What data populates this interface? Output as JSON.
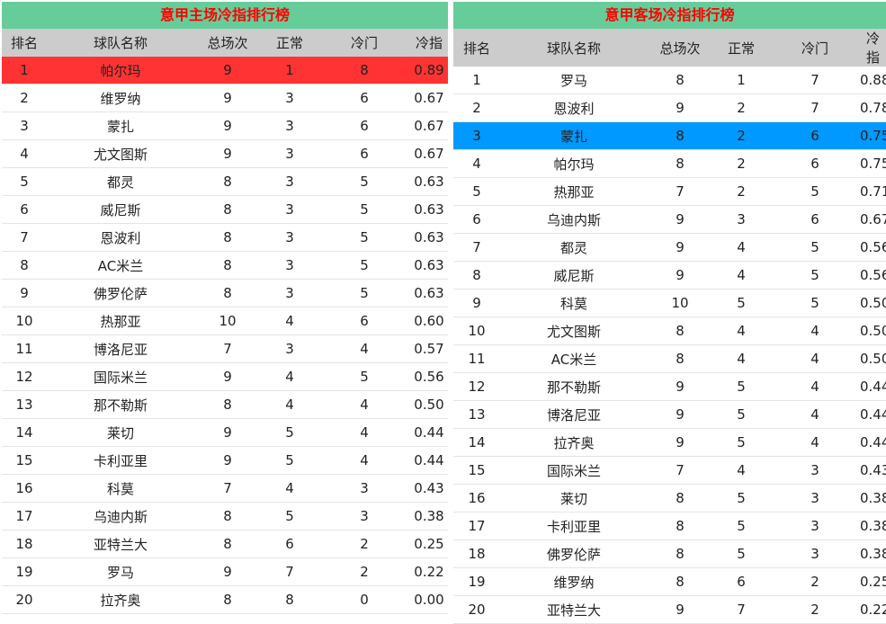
{
  "headers": [
    "排名",
    "球队名称",
    "总场次",
    "正常",
    "冷门",
    "冷指"
  ],
  "highlight_colors": {
    "red": "#ff3333",
    "blue": "#0099ff",
    "title_bg": "#66cc99",
    "title_text": "#ff0000"
  },
  "home": {
    "title": "意甲主场冷指排行榜",
    "rows": [
      [
        "1",
        "帕尔玛",
        "9",
        "1",
        "8",
        "0.89"
      ],
      [
        "2",
        "维罗纳",
        "9",
        "3",
        "6",
        "0.67"
      ],
      [
        "3",
        "蒙扎",
        "9",
        "3",
        "6",
        "0.67"
      ],
      [
        "4",
        "尤文图斯",
        "9",
        "3",
        "6",
        "0.67"
      ],
      [
        "5",
        "都灵",
        "8",
        "3",
        "5",
        "0.63"
      ],
      [
        "6",
        "威尼斯",
        "8",
        "3",
        "5",
        "0.63"
      ],
      [
        "7",
        "恩波利",
        "8",
        "3",
        "5",
        "0.63"
      ],
      [
        "8",
        "AC米兰",
        "8",
        "3",
        "5",
        "0.63"
      ],
      [
        "9",
        "佛罗伦萨",
        "8",
        "3",
        "5",
        "0.63"
      ],
      [
        "10",
        "热那亚",
        "10",
        "4",
        "6",
        "0.60"
      ],
      [
        "11",
        "博洛尼亚",
        "7",
        "3",
        "4",
        "0.57"
      ],
      [
        "12",
        "国际米兰",
        "9",
        "4",
        "5",
        "0.56"
      ],
      [
        "13",
        "那不勒斯",
        "8",
        "4",
        "4",
        "0.50"
      ],
      [
        "14",
        "莱切",
        "9",
        "5",
        "4",
        "0.44"
      ],
      [
        "15",
        "卡利亚里",
        "9",
        "5",
        "4",
        "0.44"
      ],
      [
        "16",
        "科莫",
        "7",
        "4",
        "3",
        "0.43"
      ],
      [
        "17",
        "乌迪内斯",
        "8",
        "5",
        "3",
        "0.38"
      ],
      [
        "18",
        "亚特兰大",
        "8",
        "6",
        "2",
        "0.25"
      ],
      [
        "19",
        "罗马",
        "9",
        "7",
        "2",
        "0.22"
      ],
      [
        "20",
        "拉齐奥",
        "8",
        "8",
        "0",
        "0.00"
      ]
    ],
    "highlight_row": 1,
    "highlight": "red"
  },
  "away": {
    "title": "意甲客场冷指排行榜",
    "rows": [
      [
        "1",
        "罗马",
        "8",
        "1",
        "7",
        "0.88"
      ],
      [
        "2",
        "恩波利",
        "9",
        "2",
        "7",
        "0.78"
      ],
      [
        "3",
        "蒙扎",
        "8",
        "2",
        "6",
        "0.75"
      ],
      [
        "4",
        "帕尔玛",
        "8",
        "2",
        "6",
        "0.75"
      ],
      [
        "5",
        "热那亚",
        "7",
        "2",
        "5",
        "0.71"
      ],
      [
        "6",
        "乌迪内斯",
        "9",
        "3",
        "6",
        "0.67"
      ],
      [
        "7",
        "都灵",
        "9",
        "4",
        "5",
        "0.56"
      ],
      [
        "8",
        "威尼斯",
        "9",
        "4",
        "5",
        "0.56"
      ],
      [
        "9",
        "科莫",
        "10",
        "5",
        "5",
        "0.50"
      ],
      [
        "10",
        "尤文图斯",
        "8",
        "4",
        "4",
        "0.50"
      ],
      [
        "11",
        "AC米兰",
        "8",
        "4",
        "4",
        "0.50"
      ],
      [
        "12",
        "那不勒斯",
        "9",
        "5",
        "4",
        "0.44"
      ],
      [
        "13",
        "博洛尼亚",
        "9",
        "5",
        "4",
        "0.44"
      ],
      [
        "14",
        "拉齐奥",
        "9",
        "5",
        "4",
        "0.44"
      ],
      [
        "15",
        "国际米兰",
        "7",
        "4",
        "3",
        "0.43"
      ],
      [
        "16",
        "莱切",
        "8",
        "5",
        "3",
        "0.38"
      ],
      [
        "17",
        "卡利亚里",
        "8",
        "5",
        "3",
        "0.38"
      ],
      [
        "18",
        "佛罗伦萨",
        "8",
        "5",
        "3",
        "0.38"
      ],
      [
        "19",
        "维罗纳",
        "8",
        "6",
        "2",
        "0.25"
      ],
      [
        "20",
        "亚特兰大",
        "9",
        "7",
        "2",
        "0.22"
      ]
    ],
    "highlight_row": 3,
    "highlight": "blue"
  }
}
